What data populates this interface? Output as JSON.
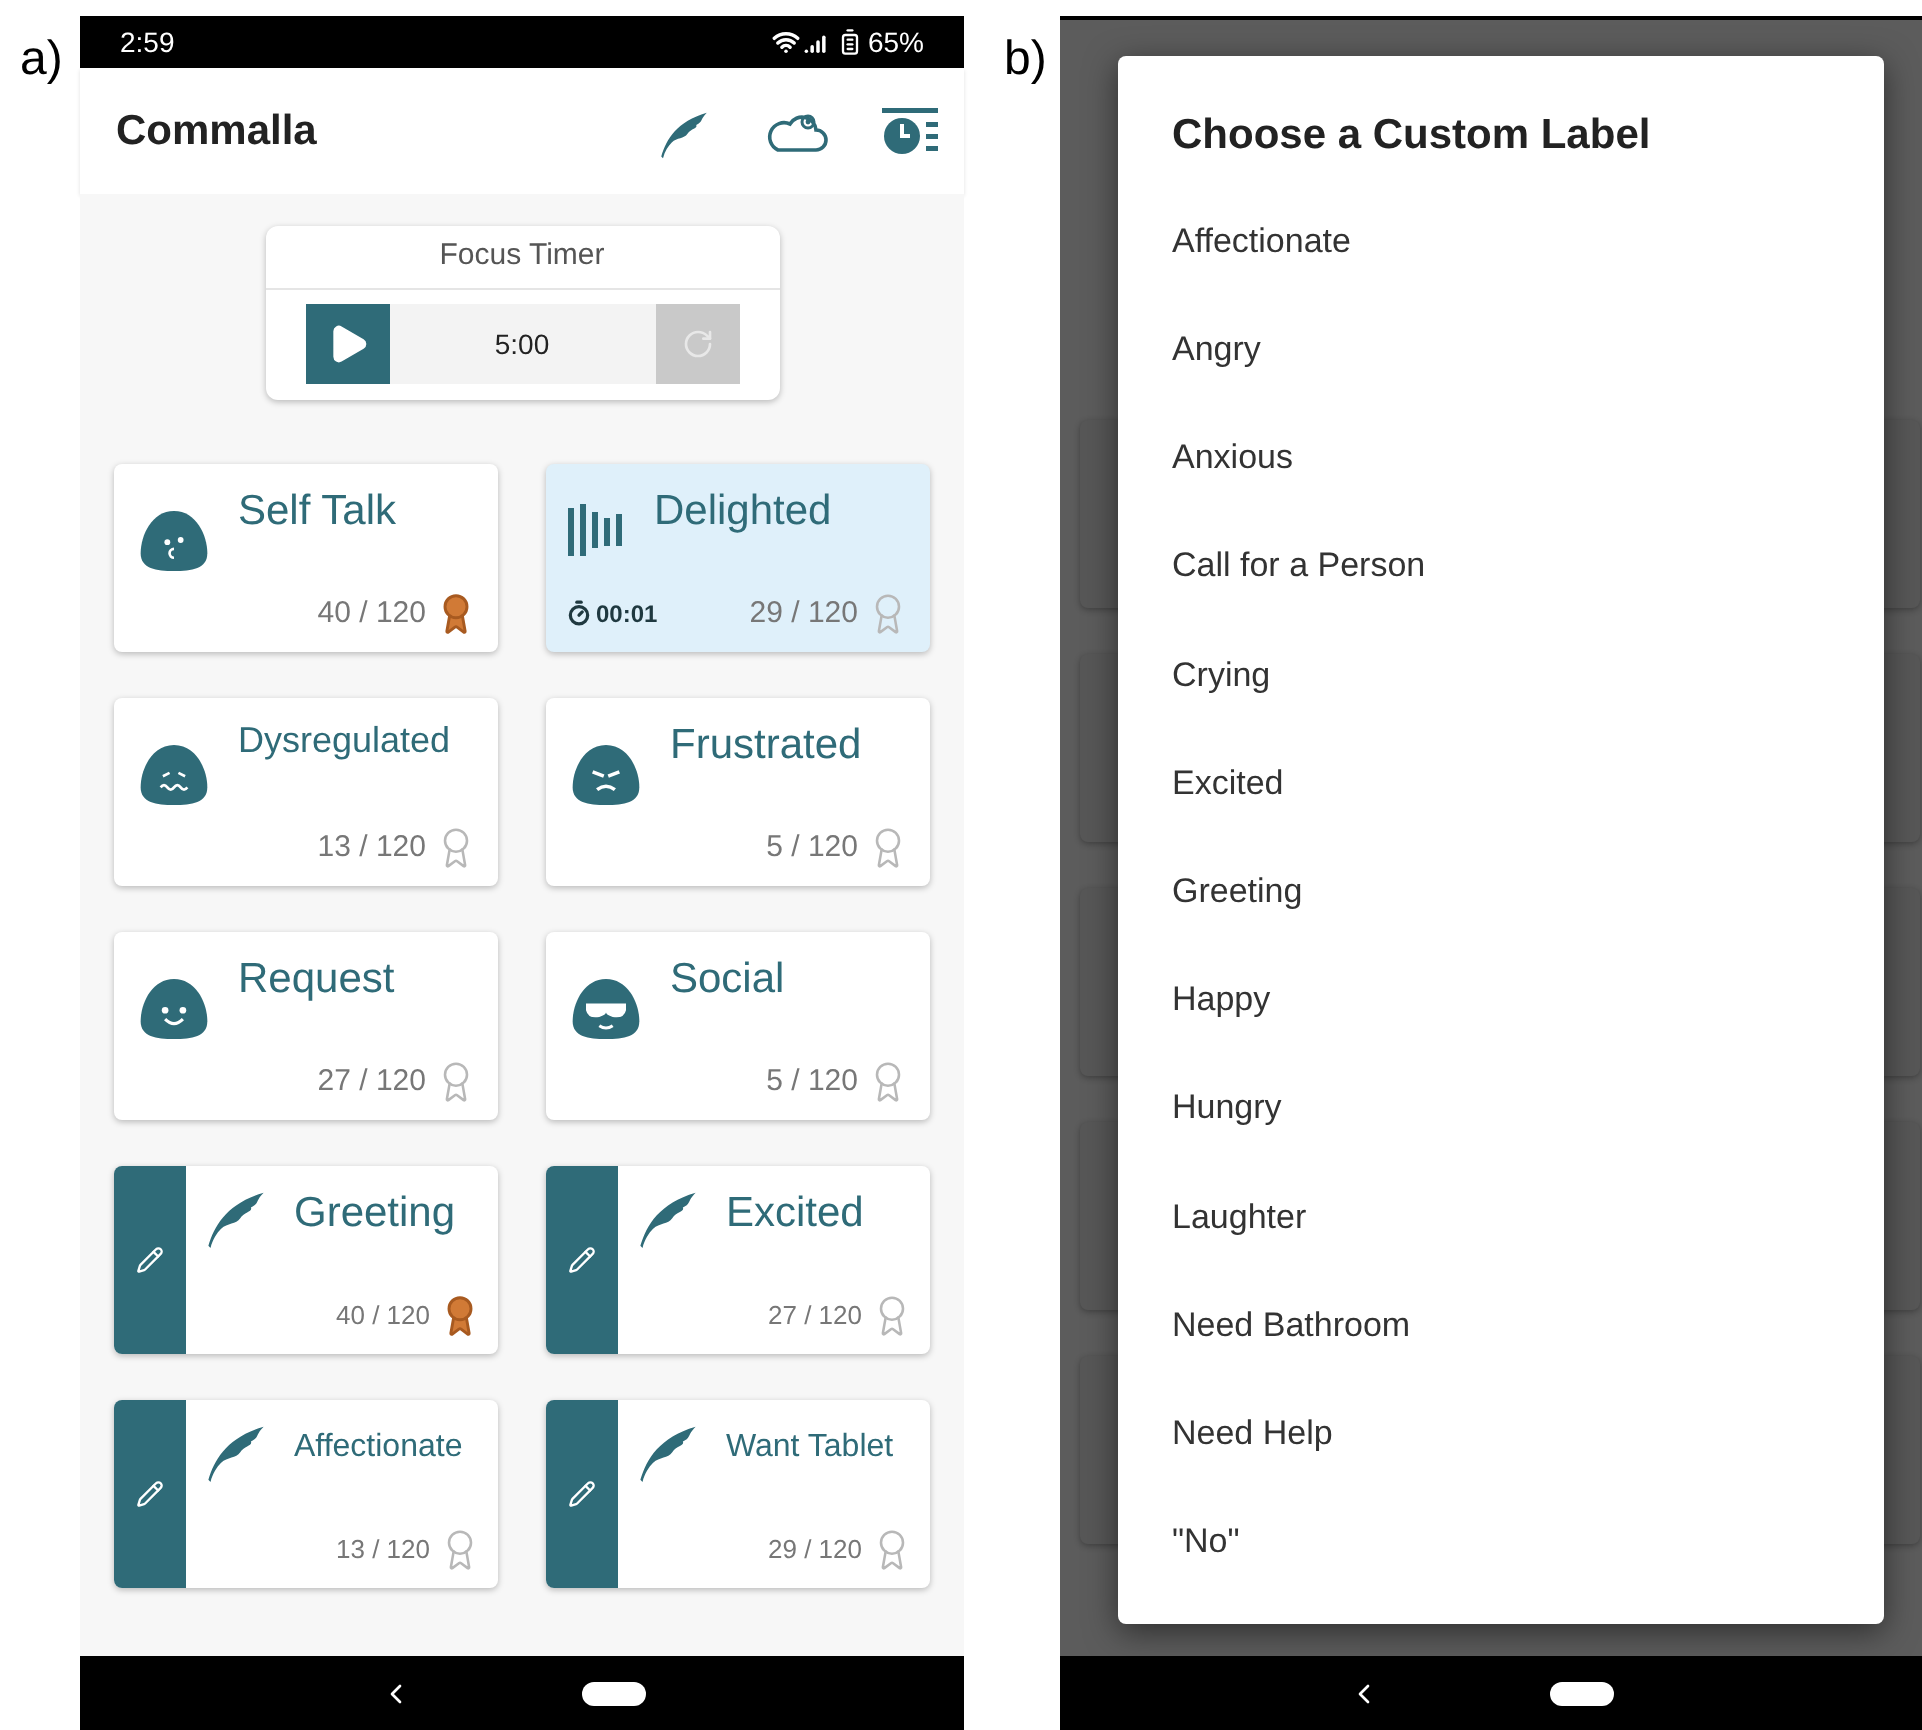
{
  "panel_a": {
    "figure_label": "a)",
    "status_bar": {
      "time": "2:59",
      "battery": "65%"
    },
    "app_bar": {
      "title": "Commalla"
    },
    "focus_timer": {
      "title": "Focus Timer",
      "time": "5:00",
      "running": false
    },
    "cards": [
      {
        "kind": "emotion",
        "label": "Self Talk",
        "count": "40 / 120",
        "earned": true,
        "selected": false
      },
      {
        "kind": "emotion",
        "label": "Delighted",
        "count": "29 / 120",
        "earned": false,
        "selected": true,
        "timer": "00:01"
      },
      {
        "kind": "emotion",
        "label": "Dysregulated",
        "count": "13 / 120",
        "earned": false,
        "selected": false
      },
      {
        "kind": "emotion",
        "label": "Frustrated",
        "count": "5 / 120",
        "earned": false,
        "selected": false
      },
      {
        "kind": "emotion",
        "label": "Request",
        "count": "27 / 120",
        "earned": false,
        "selected": false
      },
      {
        "kind": "emotion",
        "label": "Social",
        "count": "5 / 120",
        "earned": false,
        "selected": false
      },
      {
        "kind": "custom",
        "label": "Greeting",
        "count": "40 / 120",
        "earned": true,
        "selected": false
      },
      {
        "kind": "custom",
        "label": "Excited",
        "count": "27 / 120",
        "earned": false,
        "selected": false
      },
      {
        "kind": "custom",
        "label": "Affectionate",
        "count": "13 / 120",
        "earned": false,
        "selected": false
      },
      {
        "kind": "custom",
        "label": "Want Tablet",
        "count": "29 / 120",
        "earned": false,
        "selected": false
      }
    ]
  },
  "panel_b": {
    "figure_label": "b)",
    "dialog": {
      "title": "Choose a Custom Label",
      "options": [
        "Affectionate",
        "Angry",
        "Anxious",
        "Call for a Person",
        "Crying",
        "Excited",
        "Greeting",
        "Happy",
        "Hungry",
        "Laughter",
        "Need Bathroom",
        "Need Help",
        "\"No\""
      ]
    }
  }
}
